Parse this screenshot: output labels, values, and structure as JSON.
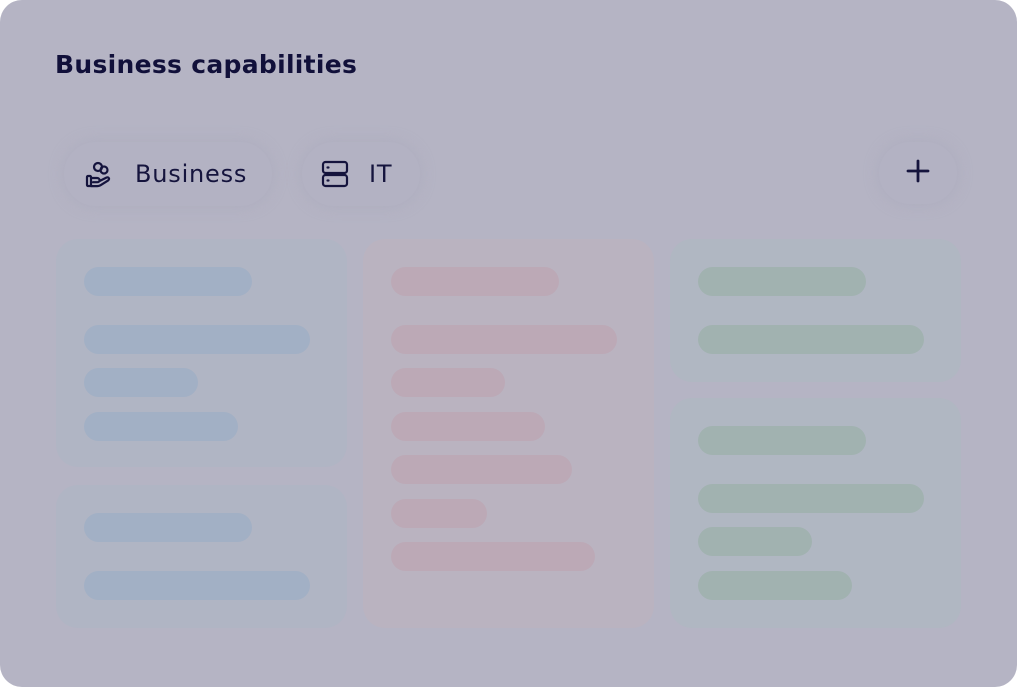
{
  "header": {
    "title": "Business capabilities"
  },
  "tabs": [
    {
      "label": "Business",
      "icon": "hand-coins-icon"
    },
    {
      "label": "IT",
      "icon": "server-icon"
    }
  ],
  "add_button": {
    "icon": "plus-icon"
  },
  "colors": {
    "overlay": "#b5b4c4",
    "text": "#11103a",
    "blue_placeholder": "#a2b0c5",
    "orange_placeholder": "#bca9b6",
    "green_placeholder": "#a1b2b0"
  }
}
